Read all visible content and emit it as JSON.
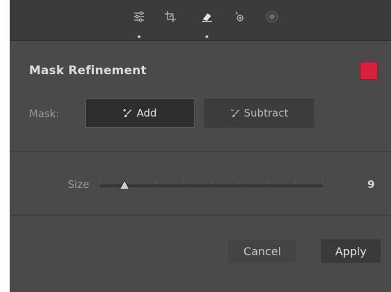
{
  "toolbar": {
    "tools": [
      {
        "icon": "sliders-icon",
        "active_dot": true
      },
      {
        "icon": "crop-icon",
        "active_dot": false
      },
      {
        "icon": "eraser-icon",
        "active_dot": true
      },
      {
        "icon": "redeye-icon",
        "active_dot": false
      },
      {
        "icon": "radial-filter-icon",
        "active_dot": false
      }
    ]
  },
  "panel": {
    "title": "Mask Refinement",
    "swatch_color": "#d91f3c",
    "mask_label": "Mask:",
    "add_label": "Add",
    "subtract_label": "Subtract",
    "size_label": "Size",
    "size_value": "9",
    "size_fraction": 0.11,
    "cancel_label": "Cancel",
    "apply_label": "Apply"
  },
  "colors": {
    "background": "#4a4a4a",
    "toolbar": "#3b3b3b",
    "accent_red": "#d91f3c"
  }
}
